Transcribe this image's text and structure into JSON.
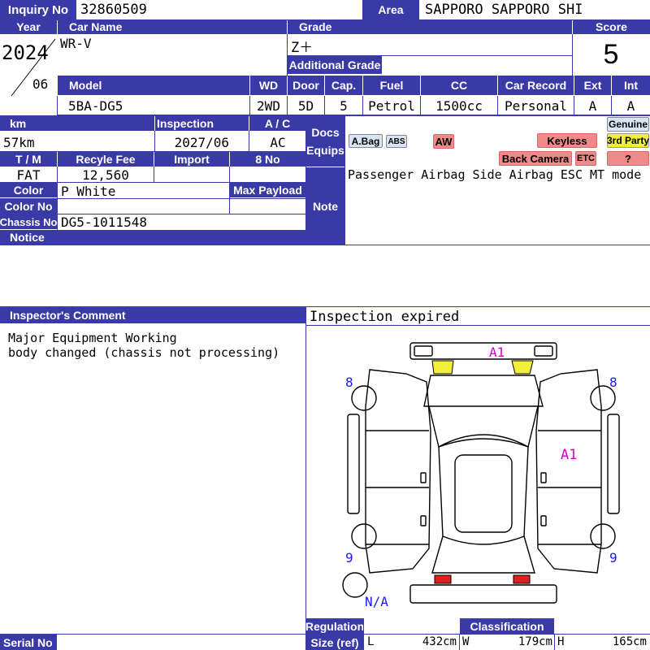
{
  "inquiry": {
    "label": "Inquiry No",
    "value": "32860509"
  },
  "area": {
    "label": "Area",
    "value": "SAPPORO SAPPORO SHI"
  },
  "year": {
    "label": "Year",
    "value": "2024",
    "month": "06"
  },
  "car_name": {
    "label": "Car Name",
    "value": "WR-V"
  },
  "grade": {
    "label": "Grade",
    "value": "Z＋",
    "additional_label": "Additional Grade",
    "additional_value": ""
  },
  "score": {
    "label": "Score",
    "value": "5"
  },
  "model": {
    "label": "Model",
    "value": "5BA-DG5"
  },
  "wd": {
    "label": "WD",
    "value": "2WD"
  },
  "door": {
    "label": "Door",
    "value": "5D"
  },
  "cap": {
    "label": "Cap.",
    "value": "5"
  },
  "fuel": {
    "label": "Fuel",
    "value": "Petrol"
  },
  "cc": {
    "label": "CC",
    "value": "1500cc"
  },
  "car_record": {
    "label": "Car Record",
    "value": "Personal"
  },
  "ext": {
    "label": "Ext",
    "value": "A"
  },
  "int": {
    "label": "Int",
    "value": "A"
  },
  "km": {
    "label": "km",
    "value": "57km"
  },
  "inspection": {
    "label": "Inspection",
    "value": "2027/06"
  },
  "ac": {
    "label": "A / C",
    "value": "AC"
  },
  "docs_equips": {
    "label_line1": "Docs",
    "label_line2": "Equips"
  },
  "equip_tags": {
    "abag": "A.Bag",
    "abs": "ABS",
    "aw": "AW",
    "keyless": "Keyless",
    "genuine": "Genuine",
    "third_party": "3rd Party",
    "back_camera": "Back Camera",
    "etc": "ETC",
    "unknown": "?"
  },
  "tm": {
    "label": "T / M",
    "value": "FAT"
  },
  "recycle_fee": {
    "label": "Recyle Fee",
    "value": "12,560"
  },
  "import": {
    "label": "Import",
    "value": ""
  },
  "eight_no": {
    "label": "8 No",
    "value": ""
  },
  "color": {
    "label": "Color",
    "value": "P White"
  },
  "max_payload": {
    "label": "Max Payload",
    "value": ""
  },
  "color_no": {
    "label": "Color No",
    "value": ""
  },
  "chassis": {
    "label": "Chassis No",
    "value": "DG5-1011548"
  },
  "notice": {
    "label": "Notice",
    "value": ""
  },
  "note": {
    "label": "Note",
    "value": "Passenger Airbag Side Airbag ESC MT mode"
  },
  "inspector_comment": {
    "label": "Inspector's Comment",
    "lines": [
      "Major Equipment Working",
      "body changed (chassis not processing)"
    ]
  },
  "inspection_status": "Inspection expired",
  "diagram_marks": {
    "front_center": "A1",
    "right_side": "A1",
    "front_left": "8",
    "front_right": "8",
    "rear_left": "9",
    "rear_right": "9",
    "spare": "N/A"
  },
  "serial": {
    "label": "Serial No",
    "value": ""
  },
  "regulation": {
    "label_line1": "Regulation",
    "label_line2": "Size (ref)"
  },
  "classification": {
    "label": "Classification",
    "value": ""
  },
  "size": {
    "l_label": "L",
    "l_value": "432cm",
    "w_label": "W",
    "w_value": "179cm",
    "h_label": "H",
    "h_value": "165cm"
  },
  "colors": {
    "header": "#3a3aa6",
    "red_tag": "#f08a8a",
    "yellow": "#f2ef3a",
    "mark": "#d100c8",
    "number": "#1a1aff"
  }
}
